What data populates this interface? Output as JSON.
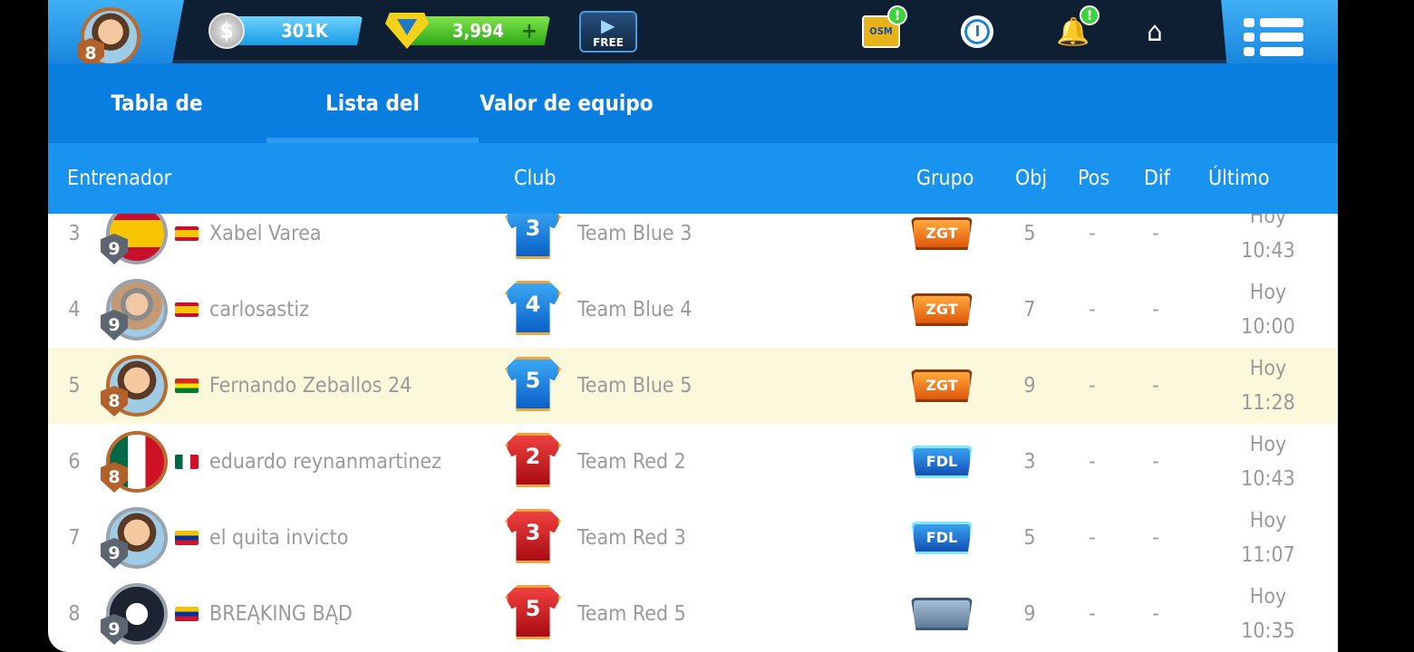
{
  "topbar": {
    "player_level": "8",
    "coins_icon": "$",
    "coins": "301K",
    "gems": "3,994",
    "gems_plus": "+",
    "free_video_label": "FREE",
    "osm_label": "OSM",
    "notification_mark": "!",
    "icons": [
      "coin-icon",
      "gem-icon",
      "free-video-icon",
      "osm-icon",
      "stopwatch-icon",
      "bell-icon",
      "home-icon",
      "menu-icon"
    ]
  },
  "tabs": [
    {
      "label": "Tabla de clasificación",
      "active": false
    },
    {
      "label": "Lista del entrenador",
      "active": true
    },
    {
      "label": "Valor de equipo",
      "active": false
    }
  ],
  "table": {
    "headers": {
      "coach": "Entrenador",
      "club": "Club",
      "group": "Grupo",
      "obj": "Obj",
      "pos": "Pos",
      "dif": "Dif",
      "last_access": "Último acceso"
    },
    "rows": [
      {
        "rank": "3",
        "level": "9",
        "flag": "es",
        "name": "Xabel Varea",
        "shirt_number": "3",
        "shirt_color": "blue",
        "team": "Team Blue 3",
        "group": "ZGT",
        "obj": "5",
        "pos": "-",
        "dif": "-",
        "day": "Hoy",
        "time": "10:43"
      },
      {
        "rank": "4",
        "level": "9",
        "flag": "es",
        "name": "carlosastiz",
        "shirt_number": "4",
        "shirt_color": "blue",
        "team": "Team Blue 4",
        "group": "ZGT",
        "obj": "7",
        "pos": "-",
        "dif": "-",
        "day": "Hoy",
        "time": "10:00"
      },
      {
        "rank": "5",
        "level": "8",
        "flag": "bo",
        "name": "Fernando Zeballos 24",
        "shirt_number": "5",
        "shirt_color": "blue",
        "team": "Team Blue 5",
        "group": "ZGT",
        "obj": "9",
        "pos": "-",
        "dif": "-",
        "day": "Hoy",
        "time": "11:28"
      },
      {
        "rank": "6",
        "level": "8",
        "flag": "mx",
        "name": "eduardo reynanmartinez",
        "shirt_number": "2",
        "shirt_color": "red",
        "team": "Team Red 2",
        "group": "FDL",
        "obj": "3",
        "pos": "-",
        "dif": "-",
        "day": "Hoy",
        "time": "10:43"
      },
      {
        "rank": "7",
        "level": "9",
        "flag": "ve",
        "name": "el quita invicto",
        "shirt_number": "3",
        "shirt_color": "red",
        "team": "Team Red 3",
        "group": "FDL",
        "obj": "5",
        "pos": "-",
        "dif": "-",
        "day": "Hoy",
        "time": "11:07"
      },
      {
        "rank": "8",
        "level": "9",
        "flag": "ve",
        "name": "BRΕĄKING BĄD",
        "shirt_number": "5",
        "shirt_color": "red",
        "team": "Team Red 5",
        "group": "",
        "obj": "9",
        "pos": "-",
        "dif": "-",
        "day": "Hoy",
        "time": "10:35"
      }
    ]
  },
  "colors": {
    "topbar": "#0f1f33",
    "tab_bar": "#0a7ee0",
    "header_row": "#1893ef",
    "highlight_row": "#fcf8dc",
    "text_muted": "#9a9a9a"
  }
}
